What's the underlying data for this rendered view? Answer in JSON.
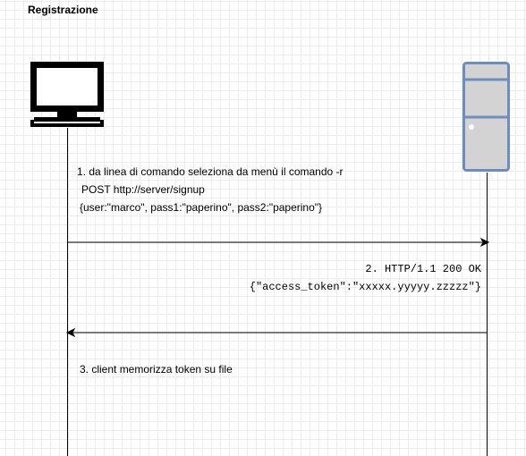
{
  "title": "Registrazione",
  "actors": {
    "client": {
      "icon": "computer-monitor-icon"
    },
    "server": {
      "icon": "server-tower-icon"
    }
  },
  "messages": [
    {
      "direction": "client-to-server",
      "lines": [
        "1. da linea di comando seleziona da menù il comando -r",
        "POST http://server/signup",
        "{user:\"marco\", pass1:\"paperino\", pass2:\"paperino\"}"
      ]
    },
    {
      "direction": "server-to-client",
      "lines": [
        "2. HTTP/1.1 200 OK",
        "{\"access_token\":\"xxxxx.yyyyy.zzzzz\"}"
      ]
    },
    {
      "direction": "self",
      "lines": [
        "3. client memorizza token su file"
      ]
    }
  ],
  "colors": {
    "server_fill": "#d3d3d3",
    "server_stroke": "#6c8ebf",
    "grid": "#ececec",
    "line": "#000000"
  }
}
